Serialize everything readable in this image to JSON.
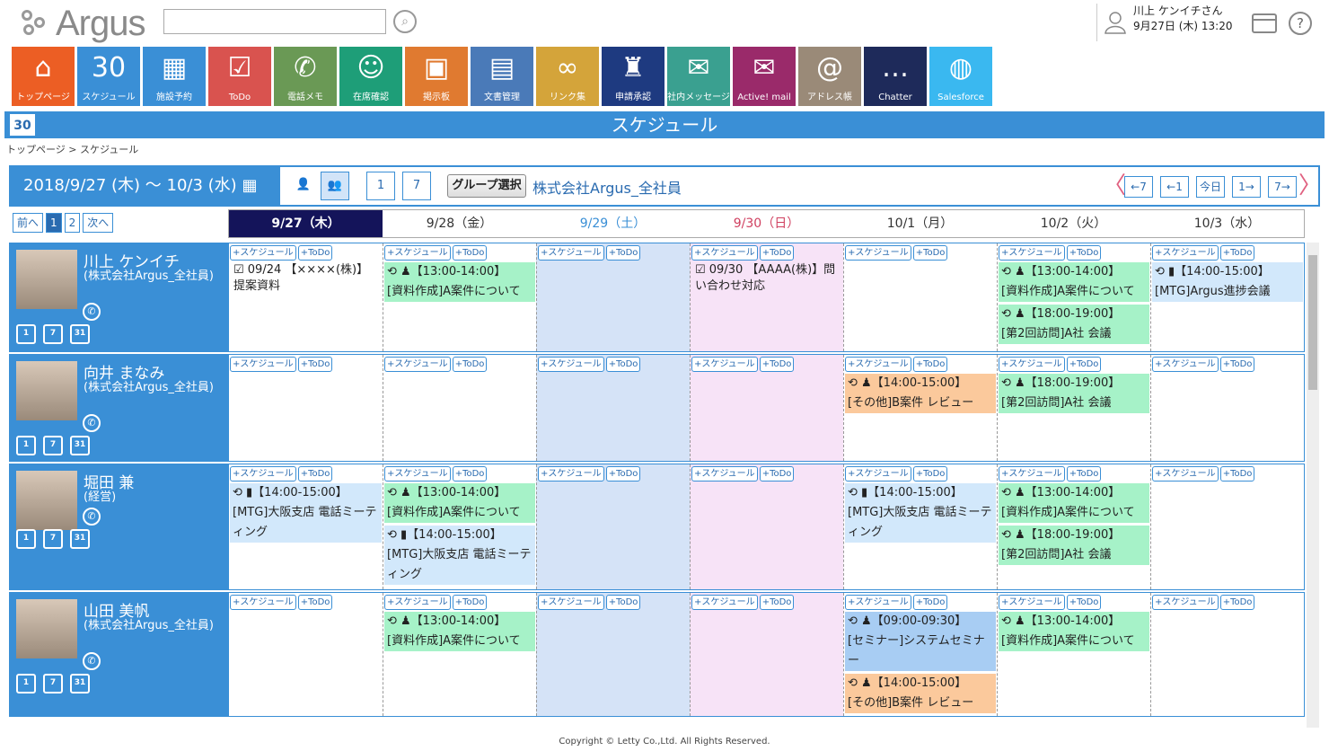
{
  "header": {
    "logo": "Argus",
    "user_name": "川上 ケンイチさん",
    "datetime": "9月27日 (木) 13:20",
    "help": "?"
  },
  "nav": [
    {
      "label": "トップページ",
      "color": "#ec5e24",
      "icon": "⌂"
    },
    {
      "label": "スケジュール",
      "color": "#3a8fd6",
      "icon": "30"
    },
    {
      "label": "施設予約",
      "color": "#3a8fd6",
      "icon": "▦"
    },
    {
      "label": "ToDo",
      "color": "#d9534f",
      "icon": "☑"
    },
    {
      "label": "電話メモ",
      "color": "#6a9955",
      "icon": "✆"
    },
    {
      "label": "在席確認",
      "color": "#1e9e78",
      "icon": "☺"
    },
    {
      "label": "掲示板",
      "color": "#e07a30",
      "icon": "▣"
    },
    {
      "label": "文書管理",
      "color": "#4a7ab8",
      "icon": "▤"
    },
    {
      "label": "リンク集",
      "color": "#d4a43a",
      "icon": "∞"
    },
    {
      "label": "申請承認",
      "color": "#1e3a80",
      "icon": "♜"
    },
    {
      "label": "社内メッセージ",
      "color": "#3aa090",
      "icon": "✉"
    },
    {
      "label": "Active! mail",
      "color": "#9a2a6a",
      "icon": "✉"
    },
    {
      "label": "アドレス帳",
      "color": "#9a8a78",
      "icon": "@"
    },
    {
      "label": "Chatter",
      "color": "#1e2a5a",
      "icon": "…"
    },
    {
      "label": "Salesforce",
      "color": "#3ab8f0",
      "icon": "◍"
    }
  ],
  "title": "スケジュール",
  "title_icon": "30",
  "breadcrumb": "トップページ > スケジュール",
  "toolbar": {
    "date_range": "2018/9/27 (木) 〜 10/3 (水)",
    "day_view": "1",
    "week_view": "7",
    "group_button": "グループ選択",
    "group_name": "株式会社Argus_全社員",
    "prev7": "←7",
    "prev1": "←1",
    "today": "今日",
    "next1": "1→",
    "next7": "7→"
  },
  "pager": {
    "prev": "前へ",
    "p1": "1",
    "p2": "2",
    "next": "次へ"
  },
  "days": [
    {
      "label": "9/27（木）",
      "kind": "today"
    },
    {
      "label": "9/28（金）",
      "kind": ""
    },
    {
      "label": "9/29（土）",
      "kind": "sat"
    },
    {
      "label": "9/30（日）",
      "kind": "sun"
    },
    {
      "label": "10/1（月）",
      "kind": ""
    },
    {
      "label": "10/2（火）",
      "kind": ""
    },
    {
      "label": "10/3（水）",
      "kind": ""
    }
  ],
  "add_schedule": "+スケジュール",
  "add_todo": "+ToDo",
  "users": [
    {
      "name": "川上 ケンイチ",
      "org": "(株式会社Argus_全社員)",
      "cells": [
        [
          {
            "t": "todo",
            "text": "☑ 09/24 【××××(株)】提案資料"
          }
        ],
        [
          {
            "t": "green",
            "time": "⟲ ♟【13:00-14:00】",
            "text": "[資料作成]A案件について"
          }
        ],
        [],
        [
          {
            "t": "todo",
            "text": "☑ 09/30 【AAAA(株)】問い合わせ対応"
          }
        ],
        [],
        [
          {
            "t": "green",
            "time": "⟲ ♟【13:00-14:00】",
            "text": "[資料作成]A案件について"
          },
          {
            "t": "green",
            "time": "⟲ ♟【18:00-19:00】",
            "text": "[第2回訪問]A社 会議"
          }
        ],
        [
          {
            "t": "lblue",
            "time": "⟲ ▮【14:00-15:00】",
            "text": "[MTG]Argus進捗会議"
          }
        ]
      ]
    },
    {
      "name": "向井 まなみ",
      "org": "(株式会社Argus_全社員)",
      "cells": [
        [],
        [],
        [],
        [],
        [
          {
            "t": "orange",
            "time": "⟲ ♟【14:00-15:00】",
            "text": "[その他]B案件 レビュー"
          }
        ],
        [
          {
            "t": "green",
            "time": "⟲ ♟【18:00-19:00】",
            "text": "[第2回訪問]A社 会議"
          }
        ],
        []
      ]
    },
    {
      "name": "堀田 兼",
      "org": "(経営)",
      "cells": [
        [
          {
            "t": "lblue",
            "time": "⟲ ▮【14:00-15:00】",
            "text": "[MTG]大阪支店 電話ミーティング"
          }
        ],
        [
          {
            "t": "green",
            "time": "⟲ ♟【13:00-14:00】",
            "text": "[資料作成]A案件について"
          },
          {
            "t": "lblue",
            "time": "⟲ ▮【14:00-15:00】",
            "text": "[MTG]大阪支店 電話ミーティング"
          }
        ],
        [],
        [],
        [
          {
            "t": "lblue",
            "time": "⟲ ▮【14:00-15:00】",
            "text": "[MTG]大阪支店 電話ミーティング"
          }
        ],
        [
          {
            "t": "green",
            "time": "⟲ ♟【13:00-14:00】",
            "text": "[資料作成]A案件について"
          },
          {
            "t": "green",
            "time": "⟲ ♟【18:00-19:00】",
            "text": "[第2回訪問]A社 会議"
          }
        ],
        []
      ]
    },
    {
      "name": "山田 美帆",
      "org": "(株式会社Argus_全社員)",
      "cells": [
        [],
        [
          {
            "t": "green",
            "time": "⟲ ♟【13:00-14:00】",
            "text": "[資料作成]A案件について"
          }
        ],
        [],
        [],
        [
          {
            "t": "blue",
            "time": "⟲ ♟【09:00-09:30】",
            "text": "[セミナー]システムセミナー"
          },
          {
            "t": "orange",
            "time": "⟲ ♟【14:00-15:00】",
            "text": "[その他]B案件 レビュー"
          }
        ],
        [
          {
            "t": "green",
            "time": "⟲ ♟【13:00-14:00】",
            "text": "[資料作成]A案件について"
          }
        ],
        []
      ]
    }
  ],
  "footer": "Copyright © Letty Co.,Ltd. All Rights Reserved."
}
